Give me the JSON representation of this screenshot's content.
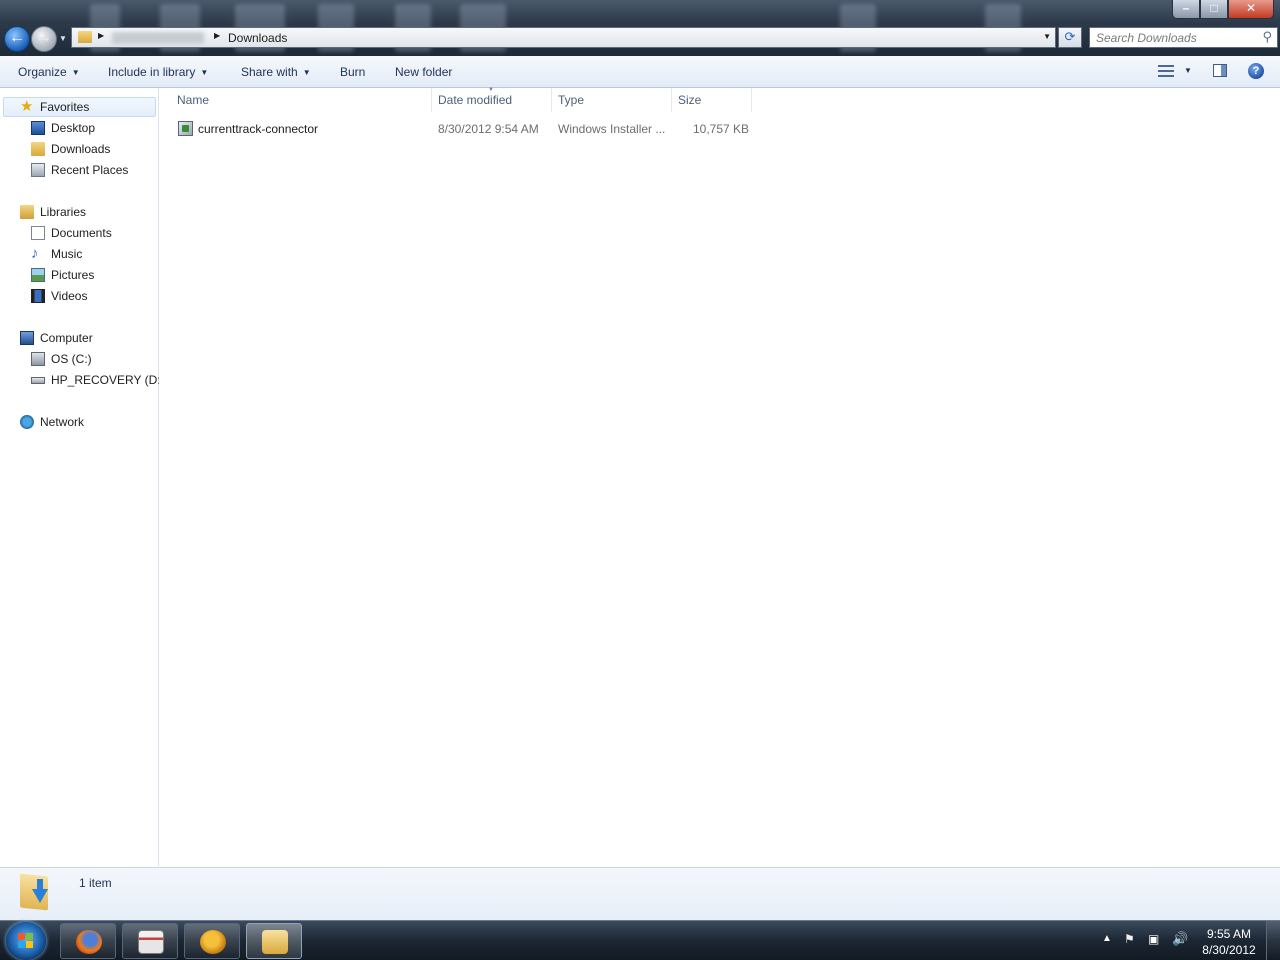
{
  "window": {
    "address": {
      "current_folder": "Downloads"
    },
    "search": {
      "placeholder": "Search Downloads"
    },
    "controls": {
      "minimize": "–",
      "maximize": "□",
      "close": "✕"
    }
  },
  "toolbar": {
    "organize": "Organize",
    "include_in_library": "Include in library",
    "share_with": "Share with",
    "burn": "Burn",
    "new_folder": "New folder"
  },
  "nav": {
    "favorites": {
      "label": "Favorites",
      "items": [
        "Desktop",
        "Downloads",
        "Recent Places"
      ]
    },
    "libraries": {
      "label": "Libraries",
      "items": [
        "Documents",
        "Music",
        "Pictures",
        "Videos"
      ]
    },
    "computer": {
      "label": "Computer",
      "items": [
        "OS (C:)",
        "HP_RECOVERY (D:)"
      ]
    },
    "network": {
      "label": "Network"
    }
  },
  "columns": {
    "name": "Name",
    "date_modified": "Date modified",
    "type": "Type",
    "size": "Size"
  },
  "files": [
    {
      "name": "currenttrack-connector",
      "date_modified": "8/30/2012 9:54 AM",
      "type": "Windows Installer ...",
      "size": "10,757 KB"
    }
  ],
  "status": {
    "item_count": "1 item"
  },
  "taskbar": {
    "time": "9:55 AM",
    "date": "8/30/2012"
  },
  "colors": {
    "accent": "#1e3256",
    "selection": "#e3eefa",
    "taskbar": "#1c2734"
  }
}
